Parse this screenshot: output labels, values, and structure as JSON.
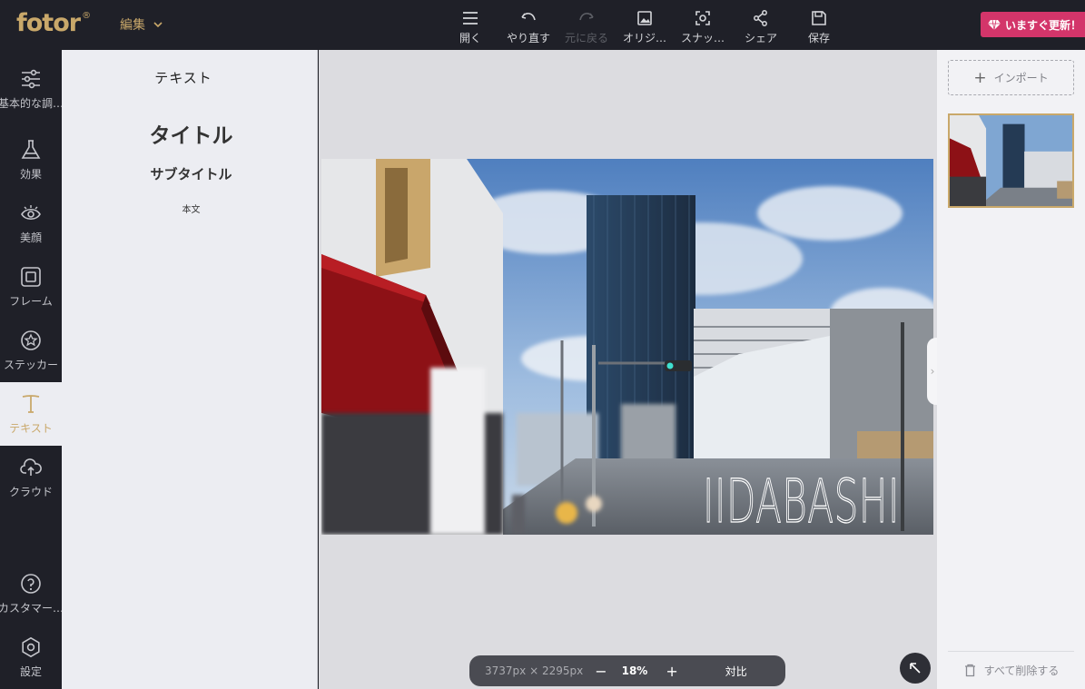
{
  "header": {
    "logo": "fotor",
    "logo_mark": "®",
    "edit_menu": "編集",
    "tools": [
      {
        "label": "開く",
        "icon": "menu-icon",
        "enabled": true
      },
      {
        "label": "やり直す",
        "icon": "undo-icon",
        "enabled": true
      },
      {
        "label": "元に戻る",
        "icon": "redo-icon",
        "enabled": false
      },
      {
        "label": "オリジ…",
        "icon": "original-image-icon",
        "enabled": true
      },
      {
        "label": "スナッ…",
        "icon": "snapshot-icon",
        "enabled": true
      },
      {
        "label": "シェア",
        "icon": "share-icon",
        "enabled": true
      },
      {
        "label": "保存",
        "icon": "save-icon",
        "enabled": true
      }
    ],
    "upgrade_label": "いますぐ更新！"
  },
  "sidebar": {
    "items": [
      {
        "label": "基本的な調…",
        "icon": "sliders-icon"
      },
      {
        "label": "効果",
        "icon": "flask-icon"
      },
      {
        "label": "美顔",
        "icon": "eye-icon"
      },
      {
        "label": "フレーム",
        "icon": "frame-icon"
      },
      {
        "label": "ステッカー",
        "icon": "sticker-icon"
      },
      {
        "label": "テキスト",
        "icon": "text-icon",
        "active": true
      },
      {
        "label": "クラウド",
        "icon": "cloud-upload-icon"
      }
    ],
    "bottom": [
      {
        "label": "カスタマー…",
        "icon": "help-icon"
      },
      {
        "label": "設定",
        "icon": "settings-gear-icon"
      }
    ]
  },
  "text_panel": {
    "title": "テキスト",
    "presets": {
      "title": "タイトル",
      "subtitle": "サブタイトル",
      "body": "本文"
    }
  },
  "canvas": {
    "overlay_text": "IIDABASHI"
  },
  "zoombar": {
    "dimensions": "3737px × 2295px",
    "minus": "−",
    "zoom": "18%",
    "plus": "+",
    "compare": "対比"
  },
  "right_panel": {
    "import_plus": "+",
    "import_label": "インポート",
    "clear_all": "すべて削除する"
  },
  "colors": {
    "accent": "#c9a86a",
    "upgrade": "#d3356a",
    "dark_bg": "#1f2028"
  }
}
